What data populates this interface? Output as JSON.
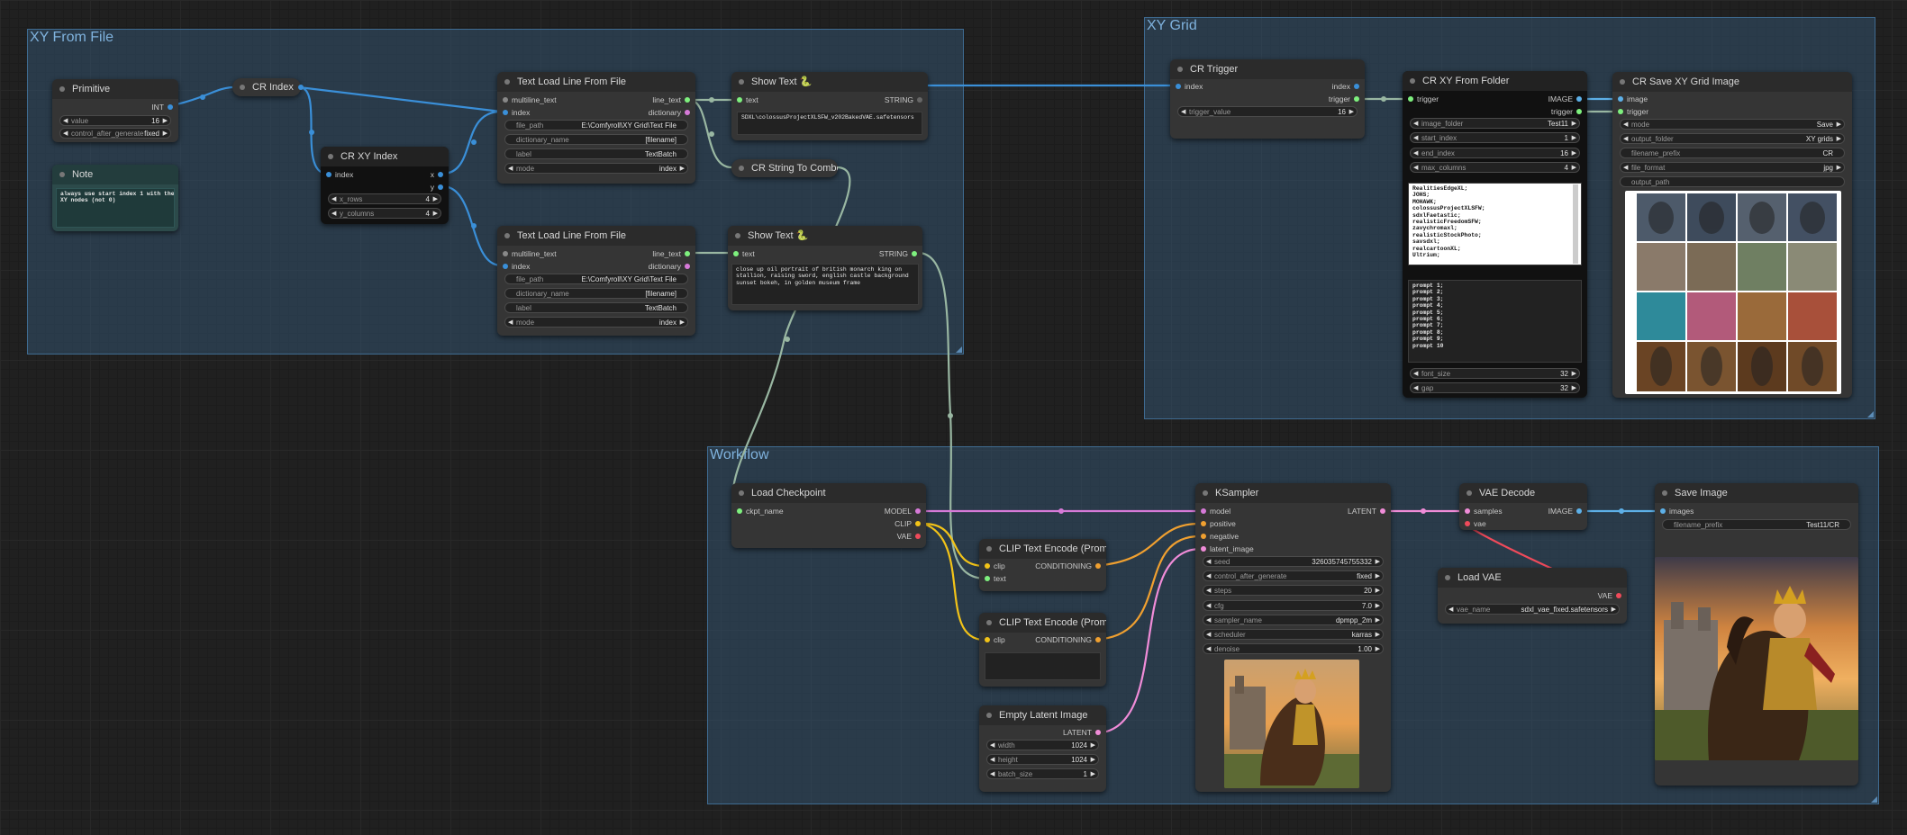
{
  "groups": {
    "xy_from_file": "XY From File",
    "xy_grid": "XY Grid",
    "workflow": "Workflow"
  },
  "nodes": {
    "primitive": {
      "title": "Primitive",
      "out": "INT",
      "value_label": "value",
      "value": "16",
      "cag_label": "control_after_generate",
      "cag_value": "fixed"
    },
    "note": {
      "title": "Note",
      "text": "always use start index 1 with the\nXY nodes (not 0)"
    },
    "cr_index": {
      "title": "CR Index"
    },
    "cr_xy_index": {
      "title": "CR XY Index",
      "in_index": "index",
      "out_x": "x",
      "out_y": "y",
      "x_rows_label": "x_rows",
      "x_rows": "4",
      "y_columns_label": "y_columns",
      "y_columns": "4"
    },
    "tlf1": {
      "title": "Text Load Line From File",
      "in_multiline": "multiline_text",
      "in_index": "index",
      "out_line": "line_text",
      "out_dict": "dictionary",
      "file_path_label": "file_path",
      "file_path": "E:\\Comfyroll\\XY Grid\\Text File",
      "dict_name_label": "dictionary_name",
      "dict_name": "[filename]",
      "label_label": "label",
      "label": "TextBatch",
      "mode_label": "mode",
      "mode": "index"
    },
    "tlf2": {
      "title": "Text Load Line From File",
      "in_multiline": "multiline_text",
      "in_index": "index",
      "out_line": "line_text",
      "out_dict": "dictionary",
      "file_path_label": "file_path",
      "file_path": "E:\\Comfyroll\\XY Grid\\Text File",
      "dict_name_label": "dictionary_name",
      "dict_name": "[filename]",
      "label_label": "label",
      "label": "TextBatch",
      "mode_label": "mode",
      "mode": "index"
    },
    "show_text1": {
      "title": "Show Text",
      "emoji": "🐍",
      "in_text": "text",
      "out": "STRING",
      "content": "SDXL\\colossusProjectXLSFW_v202BakedVAE.safetensors"
    },
    "cr_string_combo": {
      "title": "CR String To Combo"
    },
    "show_text2": {
      "title": "Show Text",
      "emoji": "🐍",
      "in_text": "text",
      "out": "STRING",
      "content": "close up oil portrait of british monarch king on\nstallion, raising sword, english castle background\nsunset bokeh, in golden museum frame"
    },
    "cr_trigger": {
      "title": "CR Trigger",
      "in_index": "index",
      "out_index": "index",
      "out_trigger": "trigger",
      "trigger_value_label": "trigger_value",
      "trigger_value": "16"
    },
    "cr_xy_folder": {
      "title": "CR XY From Folder",
      "in_trigger": "trigger",
      "out_image": "IMAGE",
      "out_trigger": "trigger",
      "image_folder_label": "image_folder",
      "image_folder": "Test11",
      "start_index_label": "start_index",
      "start_index": "1",
      "end_index_label": "end_index",
      "end_index": "16",
      "max_columns_label": "max_columns",
      "max_columns": "4",
      "models_text": "RealitiesEdgeXL;\nJOHS;\nMOHAWK;\ncolossusProjectXLSFW;\nsdxlFaetastic;\nrealisticFreedomSFW;\nzavychromaxl;\nrealisticStockPhoto;\nsavsdxl;\nrealcartoonXL;\nUltrium;",
      "prompts_text": "prompt 1;\nprompt 2;\nprompt 3;\nprompt 4;\nprompt 5;\nprompt 6;\nprompt 7;\nprompt 8;\nprompt 9;\nprompt 10",
      "font_size_label": "font_size",
      "font_size": "32",
      "gap_label": "gap",
      "gap": "32"
    },
    "cr_save_grid": {
      "title": "CR Save XY Grid Image",
      "in_image": "image",
      "in_trigger": "trigger",
      "mode_label": "mode",
      "mode": "Save",
      "output_folder_label": "output_folder",
      "output_folder": "XY grids",
      "filename_prefix_label": "filename_prefix",
      "filename_prefix": "CR",
      "file_format_label": "file_format",
      "file_format": "jpg",
      "output_path_label": "output_path"
    },
    "load_checkpoint": {
      "title": "Load Checkpoint",
      "in_ckpt": "ckpt_name",
      "out_model": "MODEL",
      "out_clip": "CLIP",
      "out_vae": "VAE"
    },
    "clip1": {
      "title": "CLIP Text Encode (Prompt)",
      "in_clip": "clip",
      "in_text": "text",
      "out": "CONDITIONING"
    },
    "clip2": {
      "title": "CLIP Text Encode (Prompt)",
      "in_clip": "clip",
      "out": "CONDITIONING"
    },
    "empty_latent": {
      "title": "Empty Latent Image",
      "out": "LATENT",
      "width_label": "width",
      "width": "1024",
      "height_label": "height",
      "height": "1024",
      "batch_label": "batch_size",
      "batch": "1"
    },
    "ksampler": {
      "title": "KSampler",
      "in_model": "model",
      "in_positive": "positive",
      "in_negative": "negative",
      "in_latent": "latent_image",
      "out": "LATENT",
      "seed_label": "seed",
      "seed": "326035745755332",
      "cag_label": "control_after_generate",
      "cag": "fixed",
      "steps_label": "steps",
      "steps": "20",
      "cfg_label": "cfg",
      "cfg": "7.0",
      "sampler_label": "sampler_name",
      "sampler": "dpmpp_2m",
      "scheduler_label": "scheduler",
      "scheduler": "karras",
      "denoise_label": "denoise",
      "denoise": "1.00"
    },
    "vae_decode": {
      "title": "VAE Decode",
      "in_samples": "samples",
      "in_vae": "vae",
      "out": "IMAGE"
    },
    "load_vae": {
      "title": "Load VAE",
      "out": "VAE",
      "vae_name_label": "vae_name",
      "vae_name": "sdxl_vae_fixed.safetensors"
    },
    "save_image": {
      "title": "Save Image",
      "in_images": "images",
      "prefix_label": "filename_prefix",
      "prefix": "Test11/CR"
    }
  },
  "colors": {
    "link_int": "#3a8fd8",
    "link_model": "#d67ad8",
    "link_clip": "#f2c318",
    "link_cond": "#f0a030",
    "link_latent": "#f08cd8",
    "link_vae": "#ef4a5a",
    "link_string": "#99b7a2",
    "link_image": "#5db0e8",
    "group": "#33526e"
  },
  "icons": {
    "primitive": "arrow-left-right-icon",
    "show_text": "python-icon"
  }
}
